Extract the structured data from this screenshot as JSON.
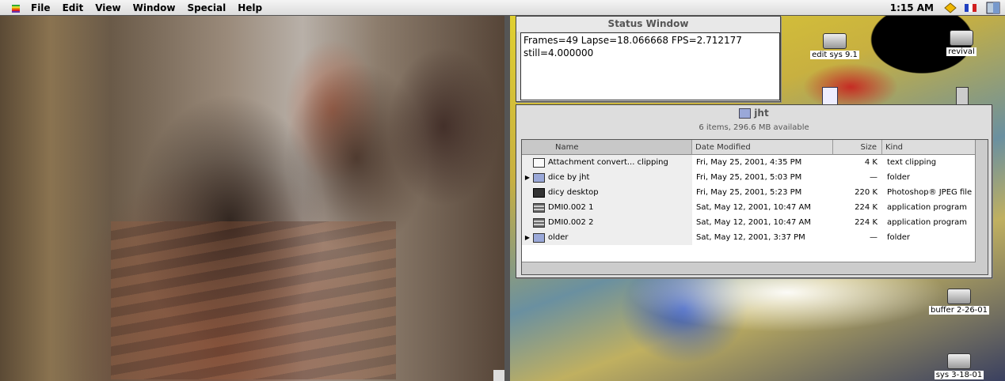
{
  "menubar": {
    "menus": [
      "File",
      "Edit",
      "View",
      "Window",
      "Special",
      "Help"
    ],
    "clock": "1:15 AM"
  },
  "status_window": {
    "title": "Status Window",
    "line1": "Frames=49 Lapse=18.066668 FPS=2.712177",
    "line2": "still=4.000000"
  },
  "finder": {
    "title": "jht",
    "info": "6 items, 296.6 MB available",
    "columns": {
      "name": "Name",
      "date": "Date Modified",
      "size": "Size",
      "kind": "Kind"
    },
    "rows": [
      {
        "name": "Attachment convert... clipping",
        "date": "Fri, May 25, 2001, 4:35 PM",
        "size": "4 K",
        "kind": "text clipping",
        "icon": "clipping-icon",
        "expandable": false
      },
      {
        "name": "dice by jht",
        "date": "Fri, May 25, 2001, 5:03 PM",
        "size": "—",
        "kind": "folder",
        "icon": "folder-icon",
        "expandable": true
      },
      {
        "name": "dicy desktop",
        "date": "Fri, May 25, 2001, 5:23 PM",
        "size": "220 K",
        "kind": "Photoshop® JPEG file",
        "icon": "jpeg-icon",
        "expandable": false
      },
      {
        "name": "DMI0.002 1",
        "date": "Sat, May 12, 2001, 10:47 AM",
        "size": "224 K",
        "kind": "application program",
        "icon": "app-icon",
        "expandable": false
      },
      {
        "name": "DMI0.002 2",
        "date": "Sat, May 12, 2001, 10:47 AM",
        "size": "224 K",
        "kind": "application program",
        "icon": "app-icon",
        "expandable": false
      },
      {
        "name": "older",
        "date": "Sat, May 12, 2001, 3:37 PM",
        "size": "—",
        "kind": "folder",
        "icon": "folder-icon",
        "expandable": true
      }
    ]
  },
  "desktop_icons": {
    "edit_sys": "edit sys 9.1",
    "revival": "revival",
    "buffer": "buffer 2-26-01",
    "sys": "sys 3-18-01"
  }
}
